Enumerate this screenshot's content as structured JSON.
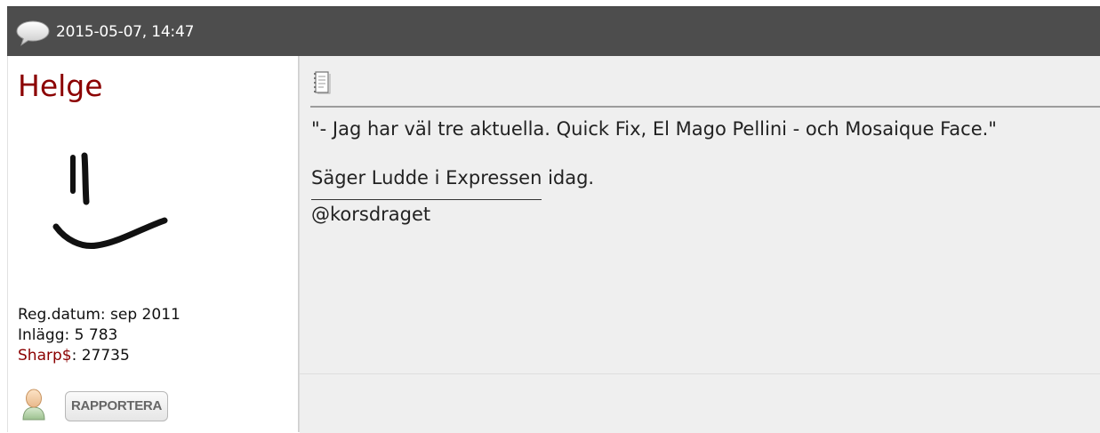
{
  "post": {
    "date": "2015-05-07, 14:47",
    "icons": {
      "header": "speech-bubble-icon",
      "message": "document-icon"
    }
  },
  "user": {
    "name": "Helge",
    "avatar": "smiley-face",
    "reg_label": "Reg.datum:",
    "reg_value": "sep 2011",
    "posts_label": "Inlägg:",
    "posts_value": "5 783",
    "sharp_label": "Sharp$",
    "sharp_sep": ":",
    "sharp_value": "27735",
    "name_color": "#8b0000"
  },
  "actions": {
    "report_label": "RAPPORTERA",
    "profile_icon": "user-profile-icon"
  },
  "message": {
    "line1": "\"- Jag har väl tre aktuella. Quick Fix, El Mago Pellini - och Mosaique Face.\"",
    "line2": "Säger Ludde i Expressen idag.",
    "signature": "@korsdraget"
  }
}
